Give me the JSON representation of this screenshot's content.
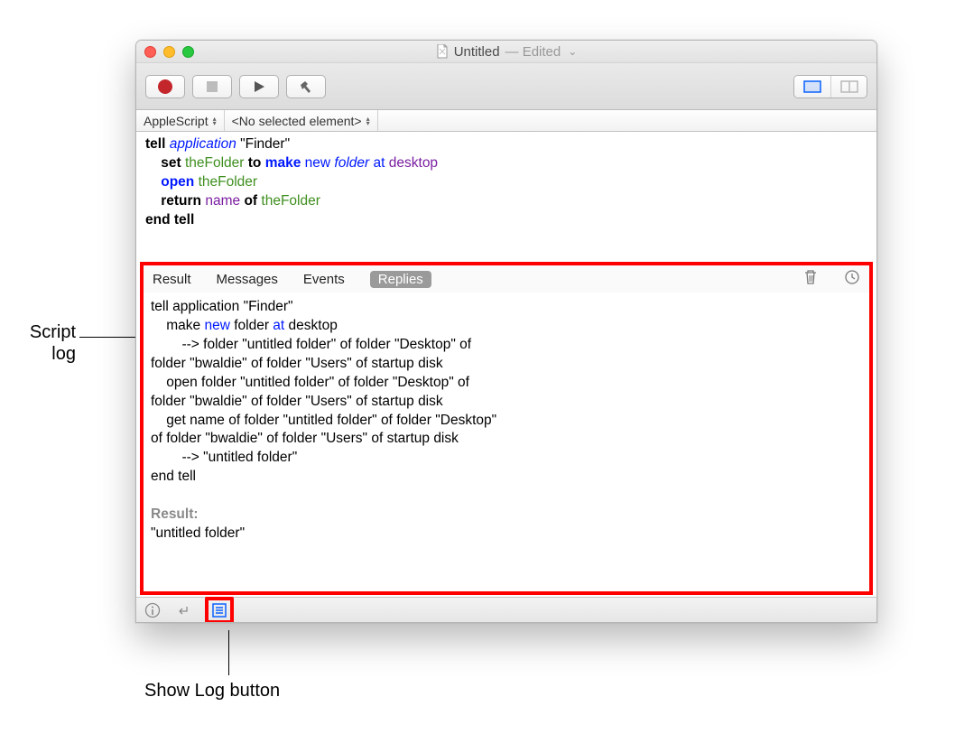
{
  "titlebar": {
    "doc_name": "Untitled",
    "edited_label": "— Edited"
  },
  "subbar": {
    "language": "AppleScript",
    "element": "<No selected element>"
  },
  "editor_script": {
    "l1_tell": "tell",
    "l1_application": "application",
    "l1_target": "\"Finder\"",
    "l2_set": "set",
    "l2_var": "theFolder",
    "l2_to": "to",
    "l2_make": "make",
    "l2_new": "new",
    "l2_class": "folder",
    "l2_at": "at",
    "l2_loc": "desktop",
    "l3_open": "open",
    "l3_var": "theFolder",
    "l4_return": "return",
    "l4_name": "name",
    "l4_of": "of",
    "l4_var": "theFolder",
    "l5_end": "end tell"
  },
  "log_tabs": {
    "result": "Result",
    "messages": "Messages",
    "events": "Events",
    "replies": "Replies"
  },
  "log": {
    "tell": "tell",
    "application": "application",
    "finder": "\"Finder\"",
    "make": "make",
    "new": "new",
    "folder": "folder",
    "at": "at",
    "desktop": "desktop",
    "arrow": "-->",
    "untitled": "\"untitled folder\"",
    "of": "of",
    "desktop_str": "\"Desktop\"",
    "bwaldie": "\"bwaldie\"",
    "users": "\"Users\"",
    "startup": "startup disk",
    "open": "open",
    "get": "get",
    "name": "name",
    "endtell": "end tell",
    "result_hdr": "Result:",
    "result_val": "\"untitled folder\""
  },
  "annotations": {
    "script_log_l1": "Script",
    "script_log_l2": "log",
    "show_log": "Show Log button"
  }
}
